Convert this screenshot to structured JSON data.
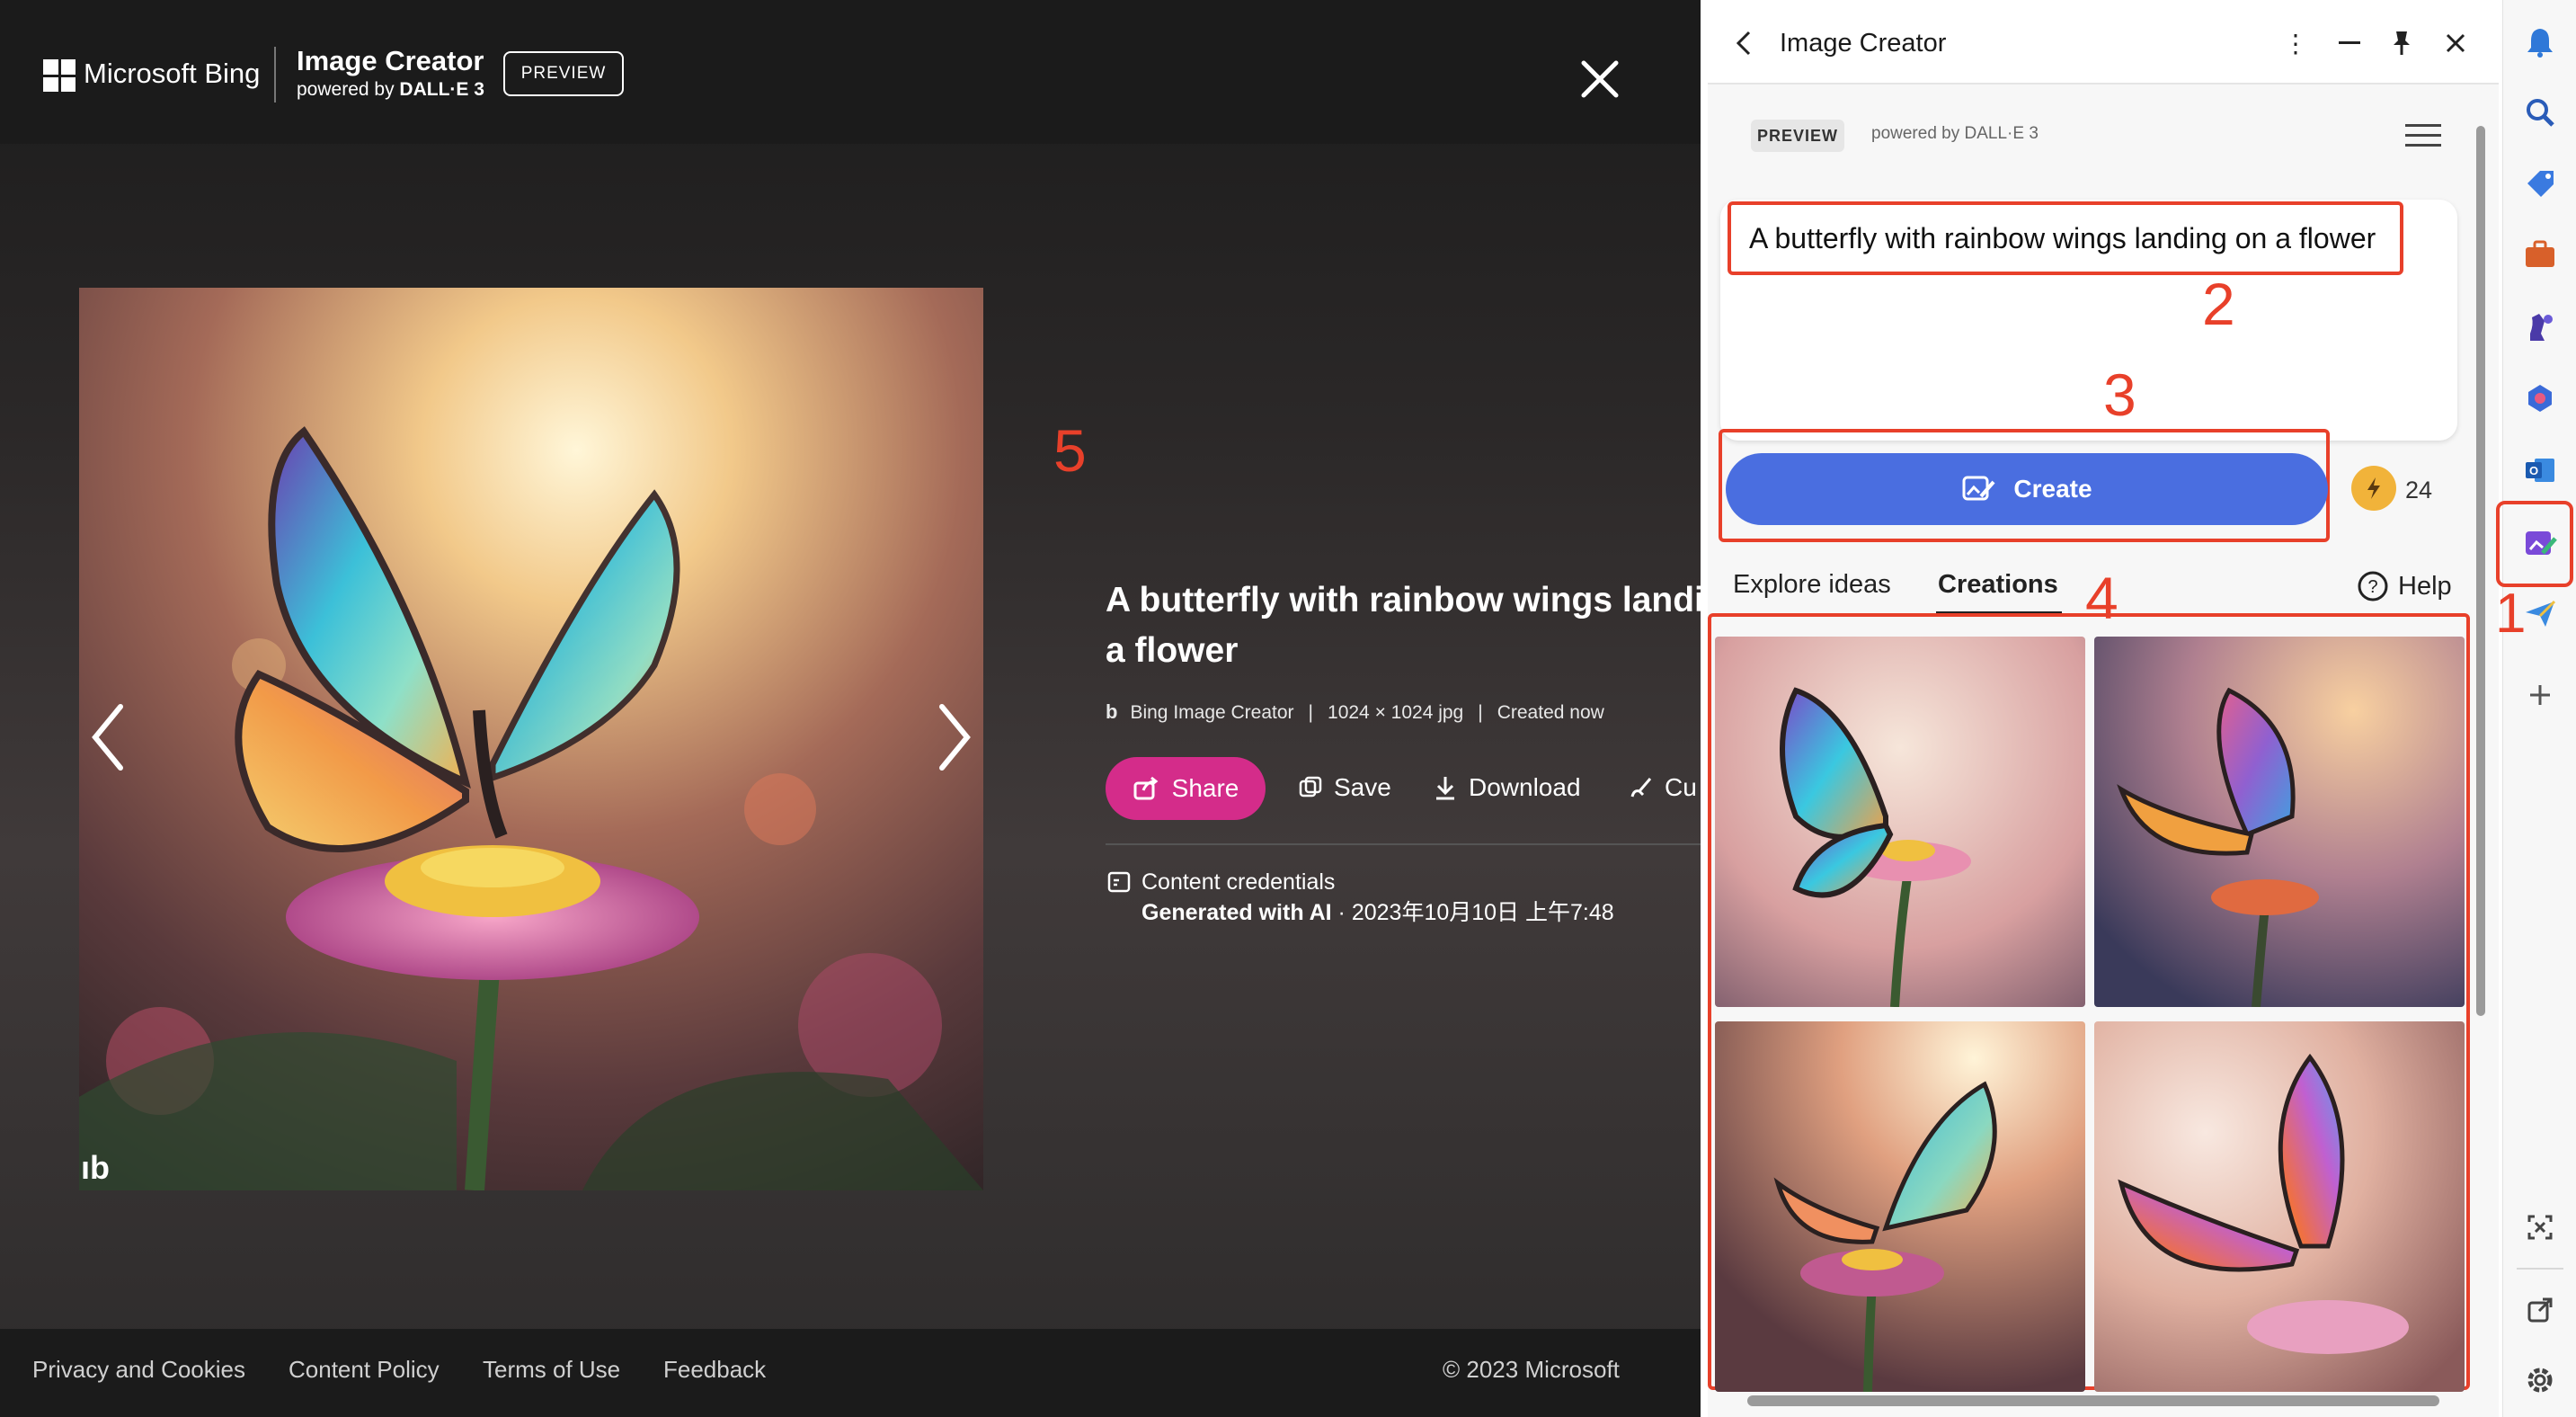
{
  "header": {
    "brand": "Microsoft Bing",
    "product_title": "Image Creator",
    "powered_prefix": "powered by",
    "powered_brand": "DALL·E 3",
    "preview_badge": "PREVIEW"
  },
  "detail": {
    "title_line1": "A butterfly with rainbow wings landin",
    "title_line2": "a flower",
    "source": "Bing Image Creator",
    "size": "1024 × 1024 jpg",
    "created": "Created now",
    "share_label": "Share",
    "save_label": "Save",
    "download_label": "Download",
    "customize_label": "Cu",
    "credentials_title": "Content credentials",
    "generated_label": "Generated with AI",
    "generated_date": " · 2023年10月10日 上午7:48"
  },
  "footer": {
    "links": [
      "Privacy and Cookies",
      "Content Policy",
      "Terms of Use",
      "Feedback"
    ],
    "copyright": "© 2023 Microsoft"
  },
  "panel": {
    "title": "Image Creator",
    "preview_badge": "PREVIEW",
    "powered_by": "powered by DALL·E 3",
    "prompt": "A butterfly with rainbow wings landing on a flower",
    "create_label": "Create",
    "boosts": "24",
    "tabs": [
      "Explore ideas",
      "Creations"
    ],
    "help_label": "Help"
  },
  "annotations": [
    "1",
    "2",
    "3",
    "4",
    "5"
  ],
  "colors": {
    "annotation_red": "#e8402a",
    "create_blue": "#4a6ee0",
    "share_pink": "#d42c8a"
  }
}
